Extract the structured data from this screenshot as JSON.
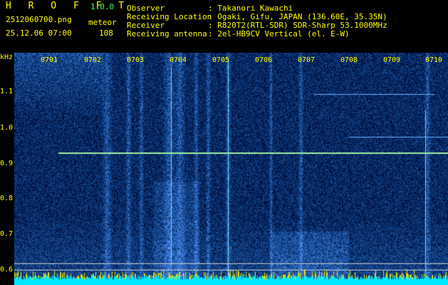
{
  "app": {
    "name": "H R O F F T",
    "version": "1.0.0"
  },
  "capture": {
    "filename": "2512060700.png",
    "datetime": "25.12.06 07:00",
    "mode_label": "meteor",
    "count": "108"
  },
  "info": {
    "rows": [
      {
        "key": "Observer",
        "value": ": Takanori Kawachi"
      },
      {
        "key": "Receiving Location",
        "value": ": Ogaki, Gifu, JAPAN (136.60E, 35.35N)"
      },
      {
        "key": "Receiver",
        "value": ": R820T2(RTL-SDR) SDR-Sharp 53.1000MHz"
      },
      {
        "key": "Receiving antenna",
        "value": ": 2el-HB9CV Vertical (el. E-W)"
      }
    ]
  },
  "axis": {
    "unit": "kHz",
    "y_ticks": [
      "1.1",
      "1.0",
      "0.9",
      "0.8",
      "0.7",
      "0.6"
    ],
    "x_ticks": [
      "0701",
      "0702",
      "0703",
      "0704",
      "0705",
      "0706",
      "0707",
      "0708",
      "0709",
      "0710"
    ]
  },
  "colors": {
    "label": "#ffff00",
    "version": "#30ff60",
    "carrier": "#9ff09f",
    "noise_floor": "#00e8ff"
  }
}
